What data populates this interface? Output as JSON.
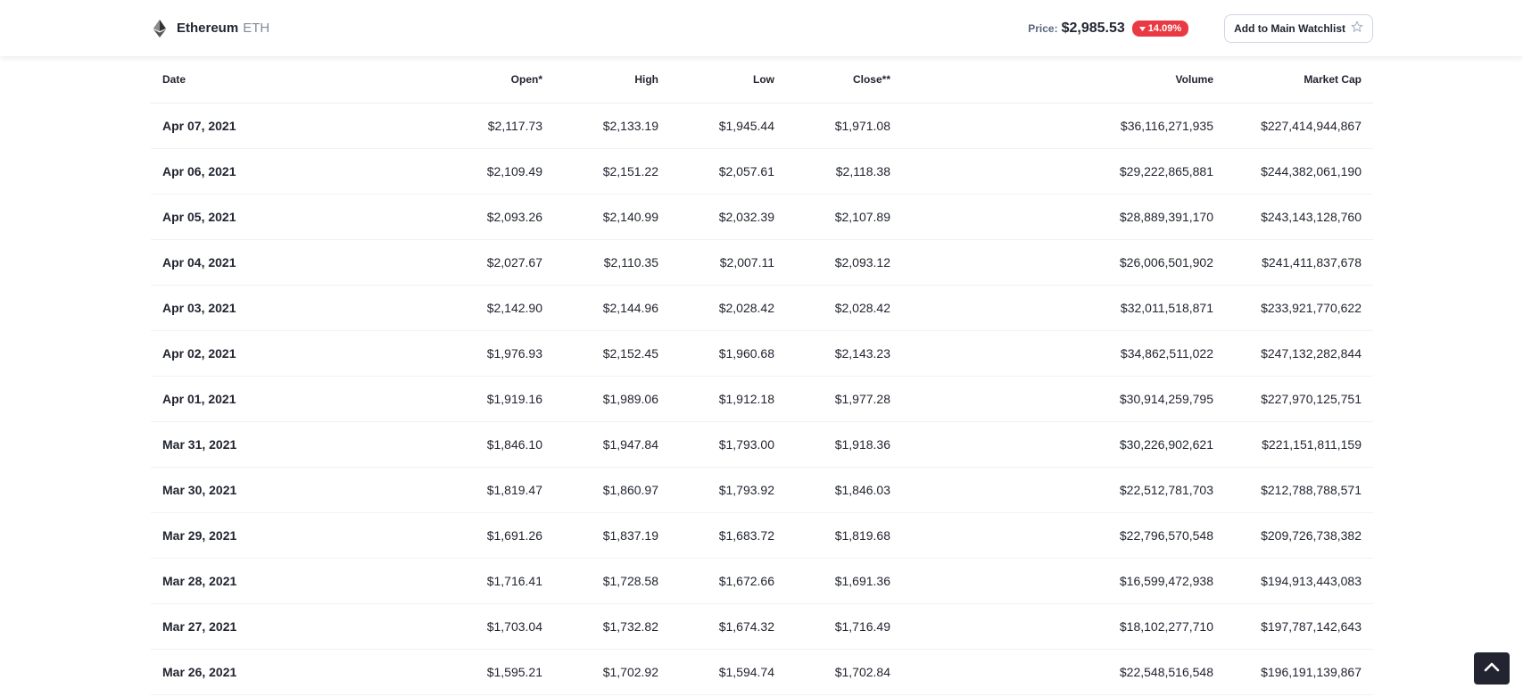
{
  "header": {
    "coin_name": "Ethereum",
    "coin_symbol": "ETH",
    "price_label": "Price:",
    "price_value": "$2,985.53",
    "change_value": "14.09%",
    "watchlist_label": "Add to Main Watchlist",
    "icons": {
      "logo": "ethereum-logo-icon",
      "change_arrow": "caret-down-icon",
      "watchlist": "star-icon",
      "scroll_top": "chevron-up-icon"
    }
  },
  "colors": {
    "accent_negative": "#ea3943",
    "text_primary": "#222531",
    "text_secondary": "#808a9d"
  },
  "table": {
    "columns": [
      "Date",
      "Open*",
      "High",
      "Low",
      "Close**",
      "Volume",
      "Market Cap"
    ],
    "rows": [
      [
        "Apr 07, 2021",
        "$2,117.73",
        "$2,133.19",
        "$1,945.44",
        "$1,971.08",
        "$36,116,271,935",
        "$227,414,944,867"
      ],
      [
        "Apr 06, 2021",
        "$2,109.49",
        "$2,151.22",
        "$2,057.61",
        "$2,118.38",
        "$29,222,865,881",
        "$244,382,061,190"
      ],
      [
        "Apr 05, 2021",
        "$2,093.26",
        "$2,140.99",
        "$2,032.39",
        "$2,107.89",
        "$28,889,391,170",
        "$243,143,128,760"
      ],
      [
        "Apr 04, 2021",
        "$2,027.67",
        "$2,110.35",
        "$2,007.11",
        "$2,093.12",
        "$26,006,501,902",
        "$241,411,837,678"
      ],
      [
        "Apr 03, 2021",
        "$2,142.90",
        "$2,144.96",
        "$2,028.42",
        "$2,028.42",
        "$32,011,518,871",
        "$233,921,770,622"
      ],
      [
        "Apr 02, 2021",
        "$1,976.93",
        "$2,152.45",
        "$1,960.68",
        "$2,143.23",
        "$34,862,511,022",
        "$247,132,282,844"
      ],
      [
        "Apr 01, 2021",
        "$1,919.16",
        "$1,989.06",
        "$1,912.18",
        "$1,977.28",
        "$30,914,259,795",
        "$227,970,125,751"
      ],
      [
        "Mar 31, 2021",
        "$1,846.10",
        "$1,947.84",
        "$1,793.00",
        "$1,918.36",
        "$30,226,902,621",
        "$221,151,811,159"
      ],
      [
        "Mar 30, 2021",
        "$1,819.47",
        "$1,860.97",
        "$1,793.92",
        "$1,846.03",
        "$22,512,781,703",
        "$212,788,788,571"
      ],
      [
        "Mar 29, 2021",
        "$1,691.26",
        "$1,837.19",
        "$1,683.72",
        "$1,819.68",
        "$22,796,570,548",
        "$209,726,738,382"
      ],
      [
        "Mar 28, 2021",
        "$1,716.41",
        "$1,728.58",
        "$1,672.66",
        "$1,691.36",
        "$16,599,472,938",
        "$194,913,443,083"
      ],
      [
        "Mar 27, 2021",
        "$1,703.04",
        "$1,732.82",
        "$1,674.32",
        "$1,716.49",
        "$18,102,277,710",
        "$197,787,142,643"
      ],
      [
        "Mar 26, 2021",
        "$1,595.21",
        "$1,702.92",
        "$1,594.74",
        "$1,702.84",
        "$22,548,516,548",
        "$196,191,139,867"
      ]
    ]
  }
}
